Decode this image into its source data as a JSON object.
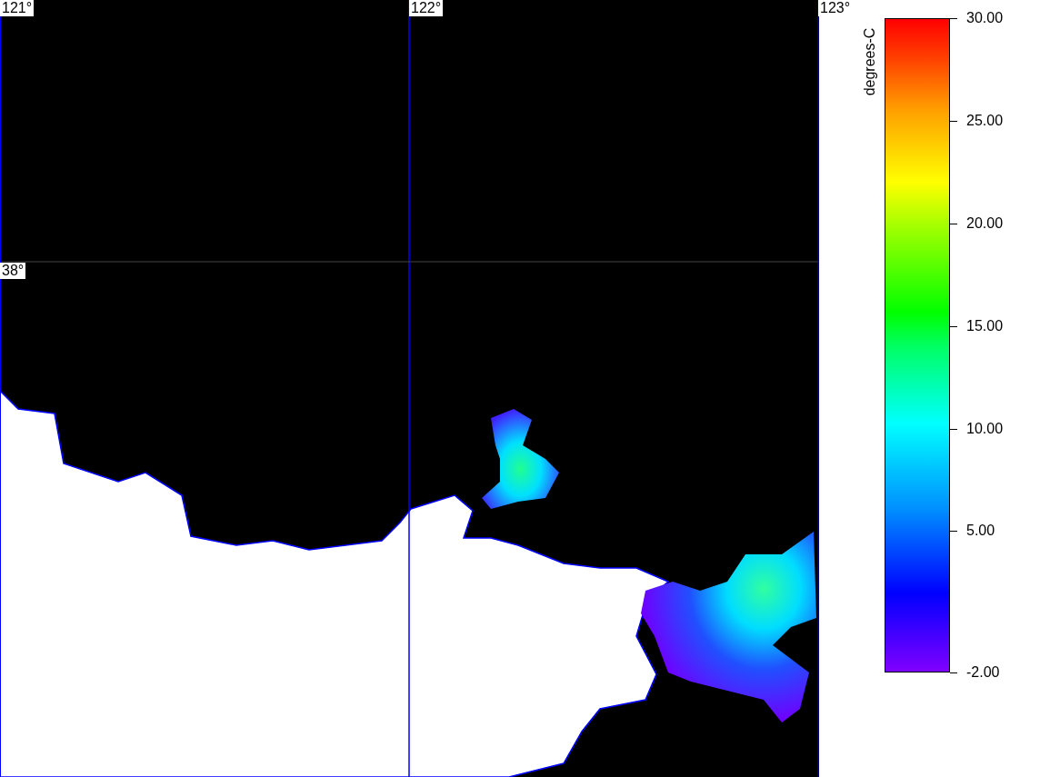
{
  "map": {
    "longitude_labels": [
      "121°",
      "122°",
      "123°"
    ],
    "latitude_labels": [
      "38°"
    ]
  },
  "colorbar": {
    "title": "degrees-C",
    "tick_labels": [
      "30.00",
      "25.00",
      "20.00",
      "15.00",
      "10.00",
      "5.00",
      "-2.00"
    ]
  }
}
